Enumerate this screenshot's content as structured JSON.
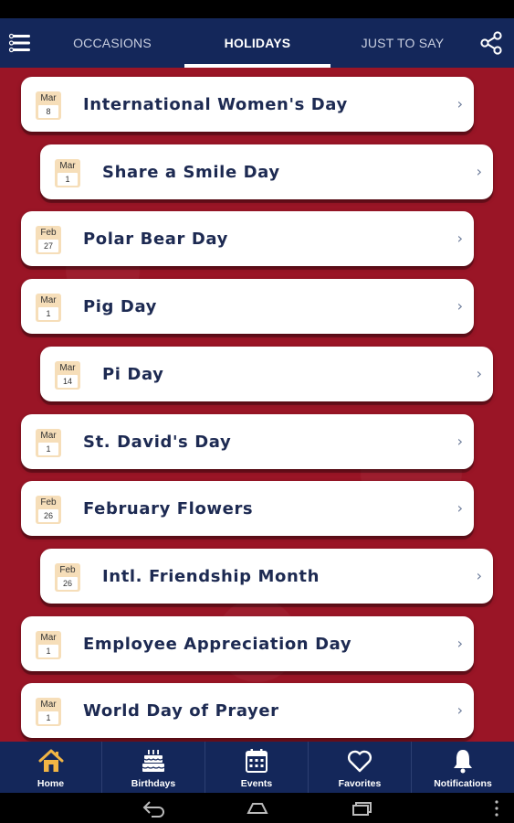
{
  "tabs": [
    {
      "label": "OCCASIONS"
    },
    {
      "label": "HOLIDAYS",
      "active": true
    },
    {
      "label": "JUST TO SAY"
    }
  ],
  "holidays": [
    {
      "month": "Mar",
      "day": "8",
      "title": "International Women's Day"
    },
    {
      "month": "Mar",
      "day": "1",
      "title": "Share a Smile Day"
    },
    {
      "month": "Feb",
      "day": "27",
      "title": "Polar Bear Day"
    },
    {
      "month": "Mar",
      "day": "1",
      "title": "Pig Day"
    },
    {
      "month": "Mar",
      "day": "14",
      "title": "Pi Day"
    },
    {
      "month": "Mar",
      "day": "1",
      "title": "St. David's Day"
    },
    {
      "month": "Feb",
      "day": "26",
      "title": "February Flowers"
    },
    {
      "month": "Feb",
      "day": "26",
      "title": "Intl. Friendship Month"
    },
    {
      "month": "Mar",
      "day": "1",
      "title": "Employee Appreciation Day"
    },
    {
      "month": "Mar",
      "day": "1",
      "title": "World Day of Prayer"
    }
  ],
  "chevron": "›",
  "bottom_nav": [
    {
      "label": "Home",
      "icon": "home-icon",
      "active": true
    },
    {
      "label": "Birthdays",
      "icon": "birthday-cake-icon"
    },
    {
      "label": "Events",
      "icon": "calendar-icon"
    },
    {
      "label": "Favorites",
      "icon": "heart-icon"
    },
    {
      "label": "Notifications",
      "icon": "bell-icon"
    }
  ],
  "colors": {
    "navy": "#14275a",
    "background_red": "#9a1526",
    "home_active": "#f2b544",
    "date_badge": "#f6deb9",
    "title_text": "#1d2a52"
  }
}
